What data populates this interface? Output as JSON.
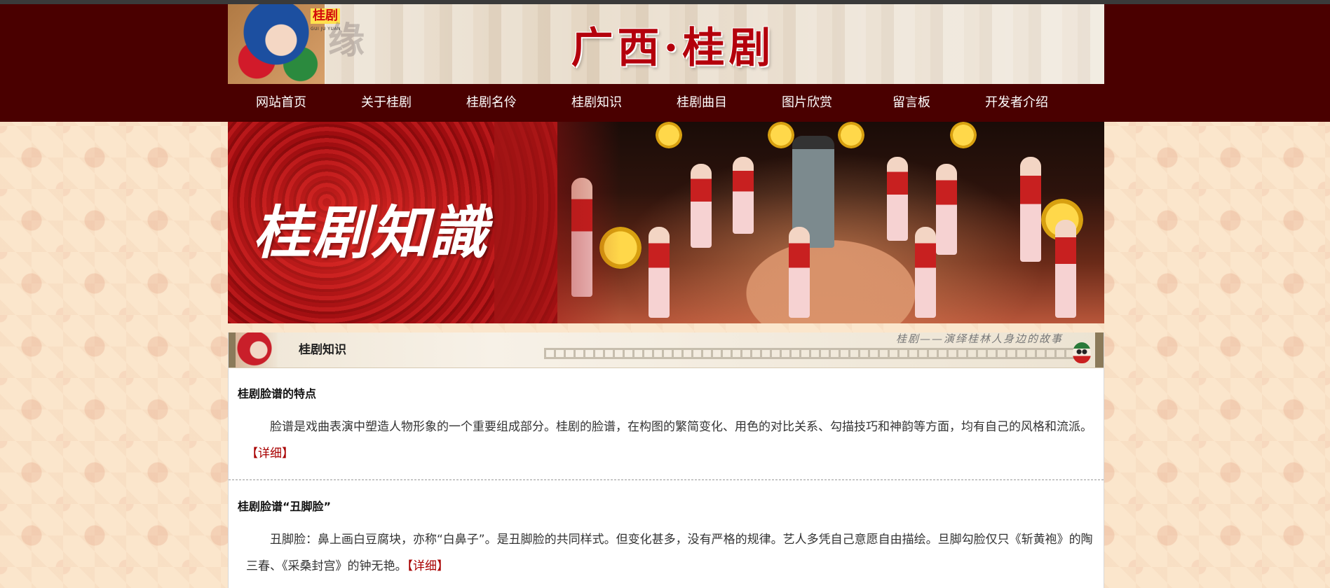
{
  "site": {
    "title": "广西·桂剧",
    "badge": "桂剧",
    "badge_sub": "GUI JU YUAN",
    "watermark": "缘"
  },
  "nav": {
    "items": [
      {
        "label": "网站首页"
      },
      {
        "label": "关于桂剧"
      },
      {
        "label": "桂剧名伶"
      },
      {
        "label": "桂剧知识"
      },
      {
        "label": "桂剧曲目"
      },
      {
        "label": "图片欣赏"
      },
      {
        "label": "留言板"
      },
      {
        "label": "开发者介绍"
      }
    ]
  },
  "banner": {
    "heading": "桂剧知識"
  },
  "section": {
    "title": "桂剧知识",
    "slogan": "桂剧——演绎桂林人身边的故事"
  },
  "articles": [
    {
      "title": "桂剧脸谱的特点",
      "body": "脸谱是戏曲表演中塑造人物形象的一个重要组成部分。桂剧的脸谱，在构图的繁简变化、用色的对比关系、勾描技巧和神韵等方面，均有自己的风格和流派。",
      "more": "【详细】"
    },
    {
      "title": "桂剧脸谱“丑脚脸”",
      "body": "丑脚脸：鼻上画白豆腐块，亦称“白鼻子”。是丑脚脸的共同样式。但变化甚多，没有严格的规律。艺人多凭自己意愿自由描绘。旦脚勾脸仅只《斩黄袍》的陶三春、《采桑封宫》的钟无艳。",
      "more": "【详细】"
    }
  ],
  "colors": {
    "header_bg": "#4a0000",
    "title_red": "#b4000c",
    "link_red": "#a80000",
    "page_bg": "#fbe6cc"
  }
}
